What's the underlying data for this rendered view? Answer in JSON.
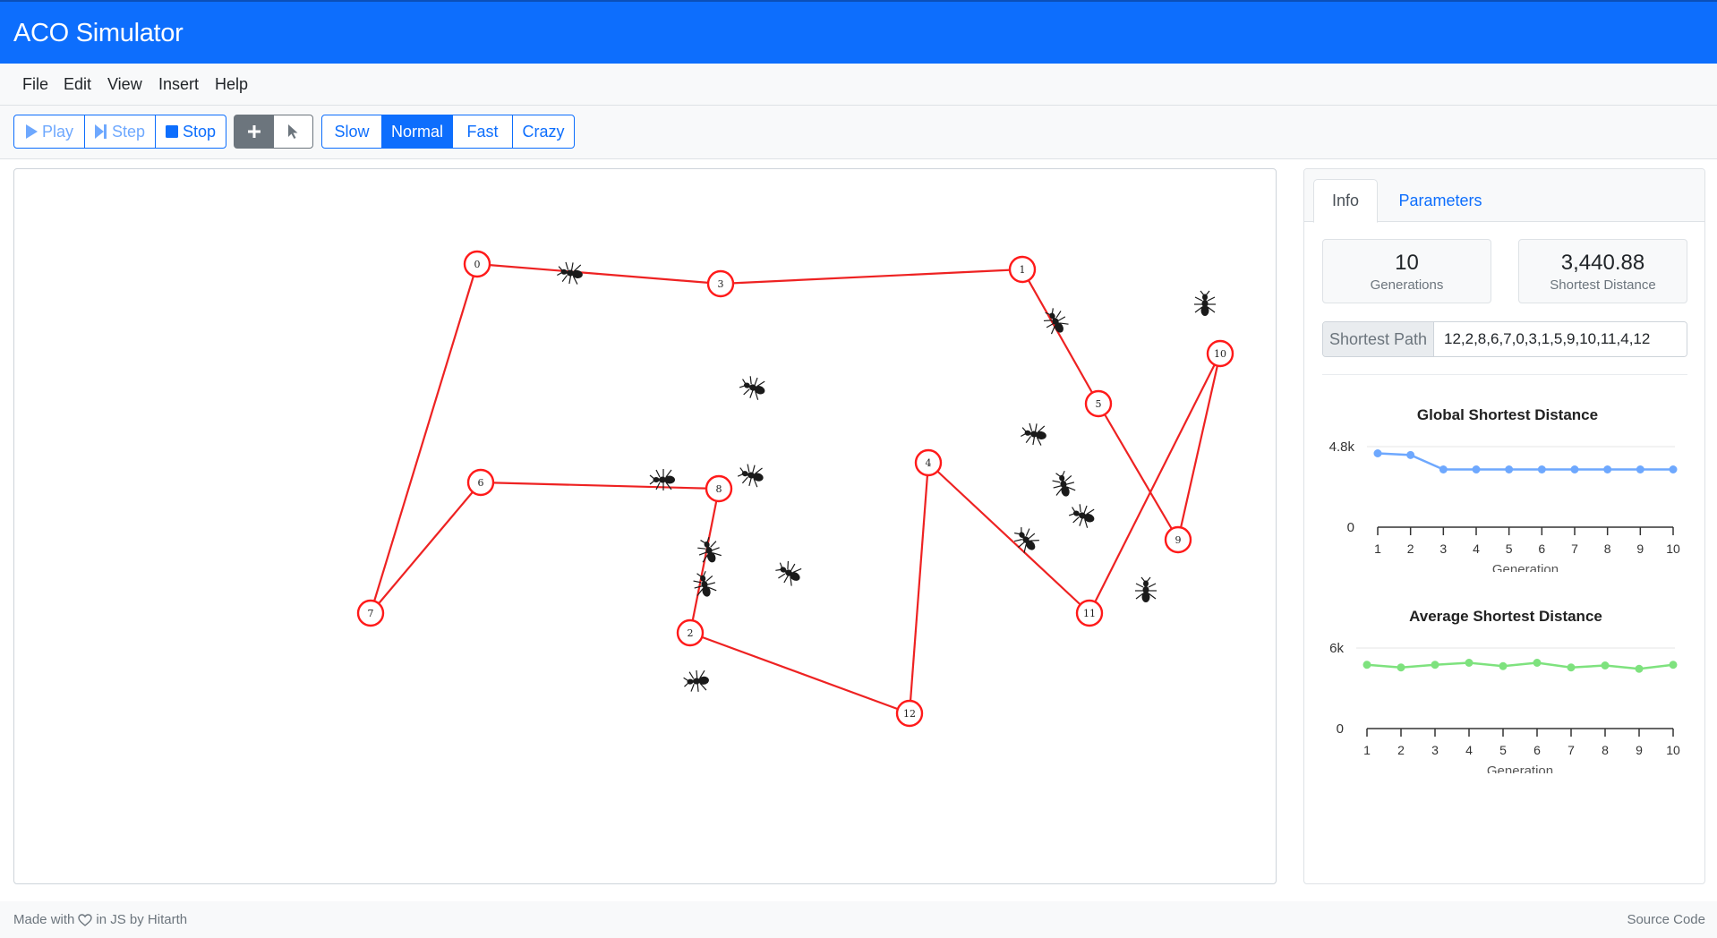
{
  "app": {
    "title": "ACO Simulator"
  },
  "menu": {
    "items": [
      "File",
      "Edit",
      "View",
      "Insert",
      "Help"
    ]
  },
  "toolbar": {
    "play_label": "Play",
    "step_label": "Step",
    "stop_label": "Stop",
    "add_tool_icon": "plus-icon",
    "select_tool_icon": "cursor-icon",
    "active_tool": "add",
    "speeds": [
      "Slow",
      "Normal",
      "Fast",
      "Crazy"
    ],
    "active_speed": "Normal"
  },
  "graph": {
    "node_color": "#ff1a1a",
    "edge_color": "#ee2222",
    "nodes": [
      {
        "id": "0"
      },
      {
        "id": "1"
      },
      {
        "id": "2"
      },
      {
        "id": "3"
      },
      {
        "id": "4"
      },
      {
        "id": "5"
      },
      {
        "id": "6"
      },
      {
        "id": "7"
      },
      {
        "id": "8"
      },
      {
        "id": "9"
      },
      {
        "id": "10"
      },
      {
        "id": "11"
      },
      {
        "id": "12"
      }
    ],
    "tour": [
      12,
      2,
      8,
      6,
      7,
      0,
      3,
      1,
      5,
      9,
      10,
      11,
      4,
      12
    ],
    "ant_count": 15
  },
  "sidebar": {
    "tabs": [
      "Info",
      "Parameters"
    ],
    "active_tab": "Info",
    "generations": {
      "value": "10",
      "label": "Generations"
    },
    "shortest_distance": {
      "value": "3,440.88",
      "label": "Shortest Distance"
    },
    "shortest_path": {
      "label": "Shortest Path",
      "value": "12,2,8,6,7,0,3,1,5,9,10,11,4,12"
    }
  },
  "chart_data": [
    {
      "type": "line",
      "title": "Global Shortest Distance",
      "xlabel": "Generation",
      "ylabel": "",
      "x": [
        1,
        2,
        3,
        4,
        5,
        6,
        7,
        8,
        9,
        10
      ],
      "series": [
        {
          "values": [
            4400,
            4300,
            3440,
            3440,
            3440,
            3440,
            3440,
            3440,
            3440,
            3440
          ]
        }
      ],
      "yticks": [
        "0",
        "4.8k"
      ],
      "ylim": [
        0,
        4800
      ],
      "grid": true,
      "color": "#6ea8fe"
    },
    {
      "type": "line",
      "title": "Average Shortest Distance",
      "xlabel": "Generation",
      "ylabel": "",
      "x": [
        1,
        2,
        3,
        4,
        5,
        6,
        7,
        8,
        9,
        10
      ],
      "series": [
        {
          "values": [
            4750,
            4550,
            4750,
            4900,
            4650,
            4900,
            4550,
            4700,
            4450,
            4750
          ]
        }
      ],
      "yticks": [
        "0",
        "6k"
      ],
      "ylim": [
        0,
        6000
      ],
      "grid": true,
      "color": "#7ee27e"
    }
  ],
  "footer": {
    "made_with": "Made with",
    "heart_icon": "heart-icon",
    "by_text": "in JS by Hitarth",
    "source_label": "Source Code"
  }
}
